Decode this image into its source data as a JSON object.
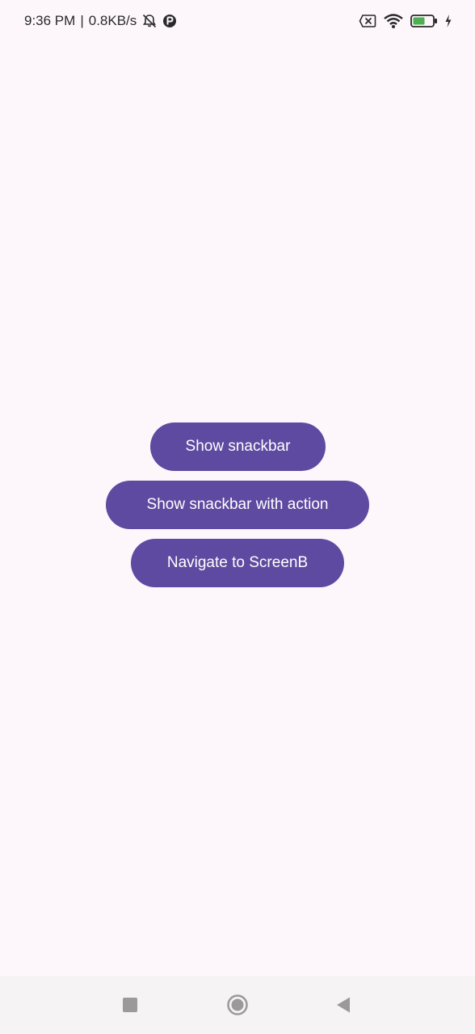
{
  "status_bar": {
    "time": "9:36 PM",
    "separator": "|",
    "net_speed": "0.8KB/s",
    "icons": [
      "bell-off-icon",
      "app-notification-icon",
      "sim-off-icon",
      "wifi-icon",
      "battery-icon",
      "charging-icon"
    ],
    "battery_level": "42"
  },
  "buttons": {
    "show_snackbar": "Show snackbar",
    "show_snackbar_with_action": "Show snackbar with action",
    "navigate_to_screenb": "Navigate to ScreenB"
  },
  "nav_bar": {
    "icons": [
      "recents-square-icon",
      "home-circle-icon",
      "back-triangle-icon"
    ]
  },
  "colors": {
    "background": "#fdf7fc",
    "button": "#5e4aa0",
    "button_text": "#ffffff",
    "nav_bar": "#f6f3f5",
    "battery_fill": "#4caf50"
  }
}
